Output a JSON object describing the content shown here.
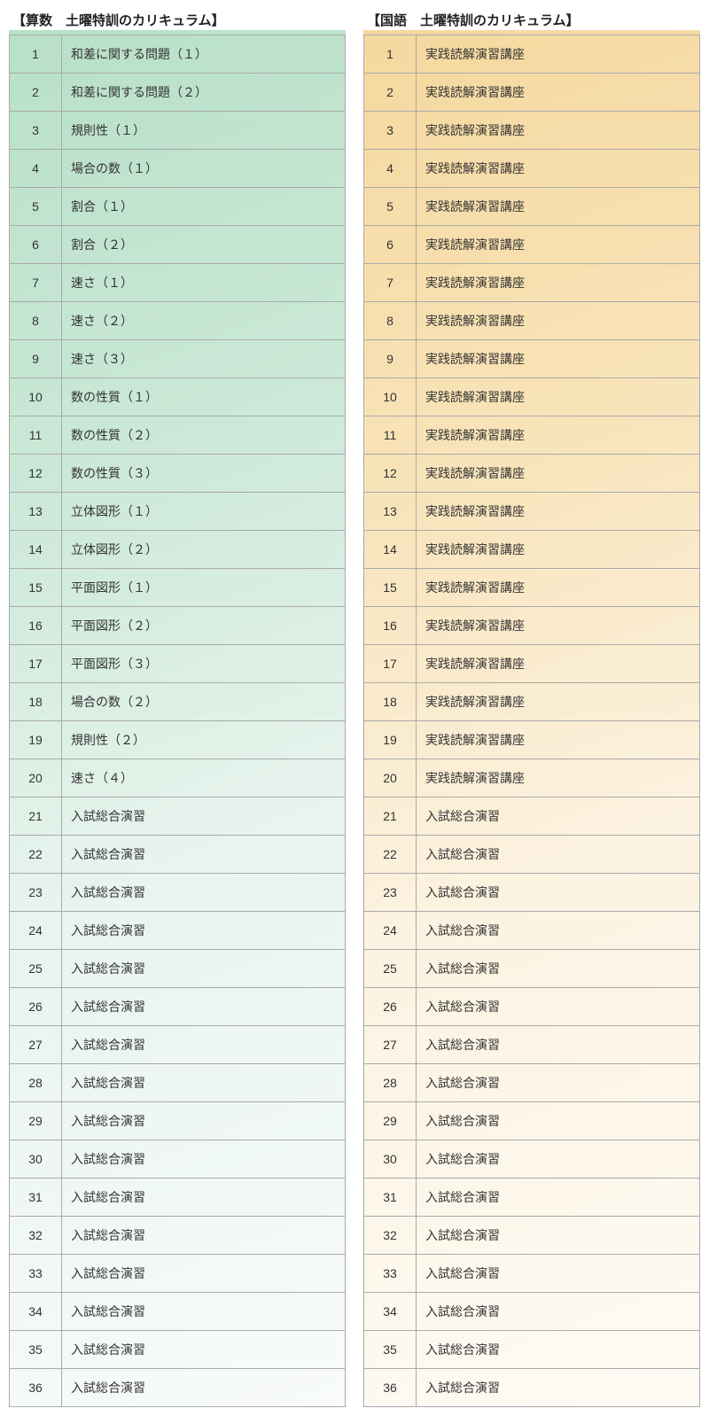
{
  "left": {
    "heading": "【算数　土曜特訓のカリキュラム】",
    "rows": [
      {
        "n": "1",
        "t": "和差に関する問題（１）"
      },
      {
        "n": "2",
        "t": "和差に関する問題（２）"
      },
      {
        "n": "3",
        "t": "規則性（１）"
      },
      {
        "n": "4",
        "t": "場合の数（１）"
      },
      {
        "n": "5",
        "t": "割合（１）"
      },
      {
        "n": "6",
        "t": "割合（２）"
      },
      {
        "n": "7",
        "t": "速さ（１）"
      },
      {
        "n": "8",
        "t": "速さ（２）"
      },
      {
        "n": "9",
        "t": "速さ（３）"
      },
      {
        "n": "10",
        "t": "数の性質（１）"
      },
      {
        "n": "11",
        "t": "数の性質（２）"
      },
      {
        "n": "12",
        "t": "数の性質（３）"
      },
      {
        "n": "13",
        "t": "立体図形（１）"
      },
      {
        "n": "14",
        "t": "立体図形（２）"
      },
      {
        "n": "15",
        "t": "平面図形（１）"
      },
      {
        "n": "16",
        "t": "平面図形（２）"
      },
      {
        "n": "17",
        "t": "平面図形（３）"
      },
      {
        "n": "18",
        "t": "場合の数（２）"
      },
      {
        "n": "19",
        "t": "規則性（２）"
      },
      {
        "n": "20",
        "t": "速さ（４）"
      },
      {
        "n": "21",
        "t": "入試総合演習"
      },
      {
        "n": "22",
        "t": "入試総合演習"
      },
      {
        "n": "23",
        "t": "入試総合演習"
      },
      {
        "n": "24",
        "t": "入試総合演習"
      },
      {
        "n": "25",
        "t": "入試総合演習"
      },
      {
        "n": "26",
        "t": "入試総合演習"
      },
      {
        "n": "27",
        "t": "入試総合演習"
      },
      {
        "n": "28",
        "t": "入試総合演習"
      },
      {
        "n": "29",
        "t": "入試総合演習"
      },
      {
        "n": "30",
        "t": "入試総合演習"
      },
      {
        "n": "31",
        "t": "入試総合演習"
      },
      {
        "n": "32",
        "t": "入試総合演習"
      },
      {
        "n": "33",
        "t": "入試総合演習"
      },
      {
        "n": "34",
        "t": "入試総合演習"
      },
      {
        "n": "35",
        "t": "入試総合演習"
      },
      {
        "n": "36",
        "t": "入試総合演習"
      }
    ]
  },
  "right": {
    "heading": "【国語　土曜特訓のカリキュラム】",
    "rows": [
      {
        "n": "1",
        "t": "実践読解演習講座"
      },
      {
        "n": "2",
        "t": "実践読解演習講座"
      },
      {
        "n": "3",
        "t": "実践読解演習講座"
      },
      {
        "n": "4",
        "t": "実践読解演習講座"
      },
      {
        "n": "5",
        "t": "実践読解演習講座"
      },
      {
        "n": "6",
        "t": "実践読解演習講座"
      },
      {
        "n": "7",
        "t": "実践読解演習講座"
      },
      {
        "n": "8",
        "t": "実践読解演習講座"
      },
      {
        "n": "9",
        "t": "実践読解演習講座"
      },
      {
        "n": "10",
        "t": "実践読解演習講座"
      },
      {
        "n": "11",
        "t": "実践読解演習講座"
      },
      {
        "n": "12",
        "t": "実践読解演習講座"
      },
      {
        "n": "13",
        "t": "実践読解演習講座"
      },
      {
        "n": "14",
        "t": "実践読解演習講座"
      },
      {
        "n": "15",
        "t": "実践読解演習講座"
      },
      {
        "n": "16",
        "t": "実践読解演習講座"
      },
      {
        "n": "17",
        "t": "実践読解演習講座"
      },
      {
        "n": "18",
        "t": "実践読解演習講座"
      },
      {
        "n": "19",
        "t": "実践読解演習講座"
      },
      {
        "n": "20",
        "t": "実践読解演習講座"
      },
      {
        "n": "21",
        "t": "入試総合演習"
      },
      {
        "n": "22",
        "t": "入試総合演習"
      },
      {
        "n": "23",
        "t": "入試総合演習"
      },
      {
        "n": "24",
        "t": "入試総合演習"
      },
      {
        "n": "25",
        "t": "入試総合演習"
      },
      {
        "n": "26",
        "t": "入試総合演習"
      },
      {
        "n": "27",
        "t": "入試総合演習"
      },
      {
        "n": "28",
        "t": "入試総合演習"
      },
      {
        "n": "29",
        "t": "入試総合演習"
      },
      {
        "n": "30",
        "t": "入試総合演習"
      },
      {
        "n": "31",
        "t": "入試総合演習"
      },
      {
        "n": "32",
        "t": "入試総合演習"
      },
      {
        "n": "33",
        "t": "入試総合演習"
      },
      {
        "n": "34",
        "t": "入試総合演習"
      },
      {
        "n": "35",
        "t": "入試総合演習"
      },
      {
        "n": "36",
        "t": "入試総合演習"
      }
    ]
  },
  "separator_after": 20
}
